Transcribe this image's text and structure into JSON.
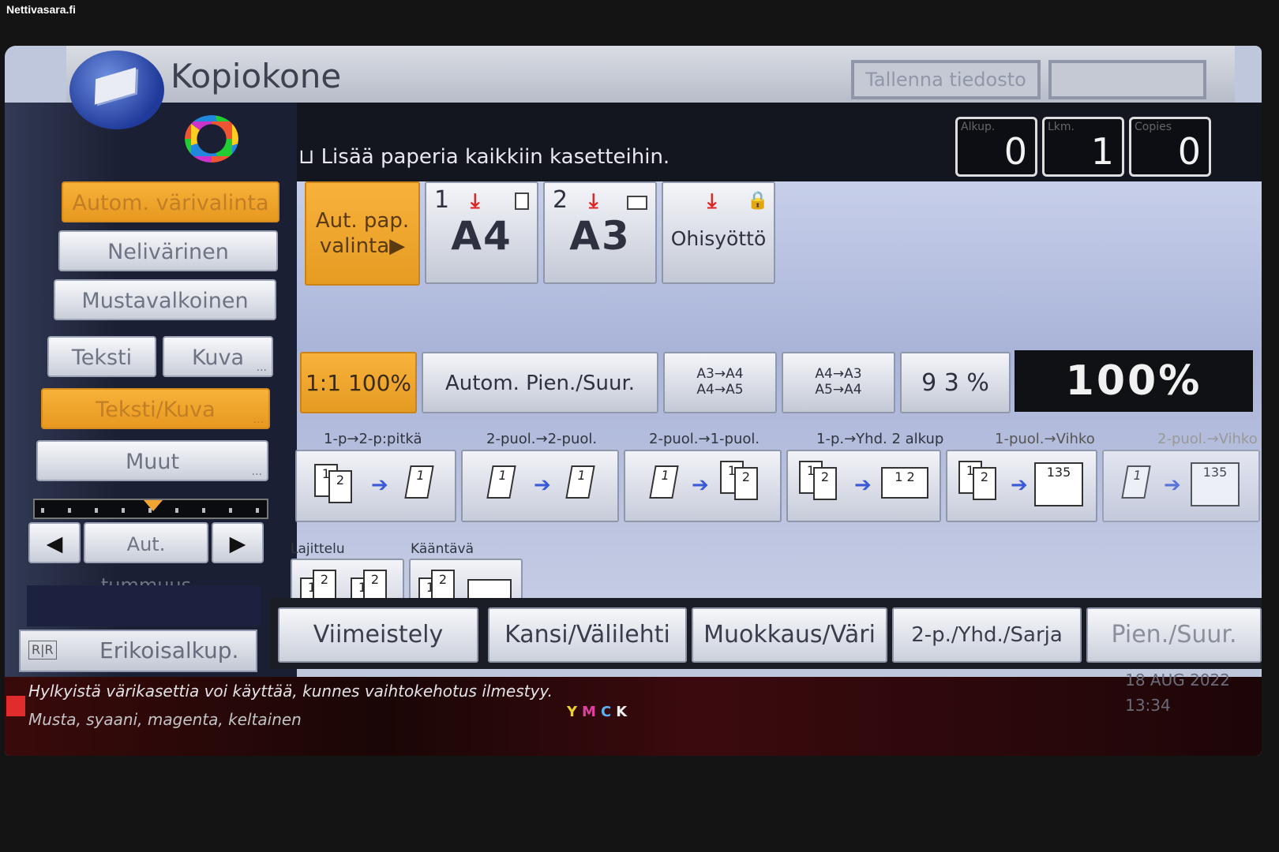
{
  "watermark": "Nettivasara.fi",
  "header": {
    "title": "Kopiokone",
    "buttons": [
      "Tallenna tiedosto",
      ""
    ]
  },
  "message": "Lisää paperia kaikkiin kasetteihin.",
  "counters": [
    {
      "label": "Alkup.",
      "value": "0"
    },
    {
      "label": "Lkm.",
      "value": "1"
    },
    {
      "label": "Copies",
      "value": "0"
    }
  ],
  "color_mode": {
    "items": [
      "Autom. värivalinta",
      "Nelivärinen",
      "Mustavalkoinen"
    ],
    "selected": "Autom. värivalinta"
  },
  "original_type": {
    "items": [
      "Teksti",
      "Kuva",
      "Teksti/Kuva",
      "Muut"
    ],
    "selected": "Teksti/Kuva"
  },
  "density": {
    "label": "Aut. tummuus",
    "left": "◀",
    "right": "▶"
  },
  "special_original": {
    "label": "Erikoisalkup.",
    "icon_text": "R|R"
  },
  "paper": {
    "auto": "Aut. pap. valinta▶",
    "trays": [
      {
        "num": "1",
        "size": "A4"
      },
      {
        "num": "2",
        "size": "A3"
      }
    ],
    "bypass": "Ohisyöttö"
  },
  "zoom": {
    "full_size": "1:1 100%",
    "auto": "Autom. Pien./Suur.",
    "preset1": [
      "A3→A4",
      "A4→A5"
    ],
    "preset2": [
      "A4→A3",
      "A5→A4"
    ],
    "pct93": "9 3 %",
    "current": "100%"
  },
  "duplex": [
    {
      "label": "1-p→2-p:pitkä"
    },
    {
      "label": "2-puol.→2-puol."
    },
    {
      "label": "2-puol.→1-puol."
    },
    {
      "label": "1-p.→Yhd. 2 alkup"
    },
    {
      "label": "1-puol.→Vihko"
    },
    {
      "label": "2-puol.→Vihko"
    }
  ],
  "finishing": {
    "sort": "Lajittelu",
    "rotate": "Kääntävä"
  },
  "tabs": [
    "Viimeistely",
    "Kansi/Välilehti",
    "Muokkaus/Väri",
    "2-p./Yhd./Sarja",
    "Pien./Suur."
  ],
  "status": {
    "line1": "Hylkyistä värikasettia voi käyttää, kunnes vaihtokehotus ilmestyy.",
    "line2": "Musta, syaani, magenta, keltainen",
    "toner": "YMCK",
    "date": "18 AUG   2022",
    "time": "13:34"
  },
  "colors": {
    "accent": "#f0a22c",
    "dark": "#14161f",
    "status_bg": "#3a0a0a"
  }
}
